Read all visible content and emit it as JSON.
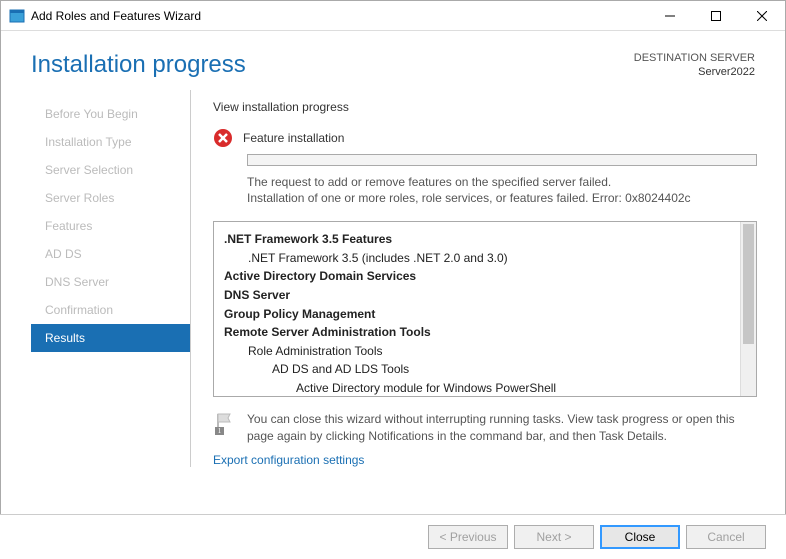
{
  "window": {
    "title": "Add Roles and Features Wizard"
  },
  "header": {
    "title": "Installation progress",
    "dest_label": "DESTINATION SERVER",
    "server_name": "Server2022"
  },
  "sidebar": {
    "steps": [
      {
        "label": "Before You Begin",
        "active": false
      },
      {
        "label": "Installation Type",
        "active": false
      },
      {
        "label": "Server Selection",
        "active": false
      },
      {
        "label": "Server Roles",
        "active": false
      },
      {
        "label": "Features",
        "active": false
      },
      {
        "label": "AD DS",
        "active": false
      },
      {
        "label": "DNS Server",
        "active": false
      },
      {
        "label": "Confirmation",
        "active": false
      },
      {
        "label": "Results",
        "active": true
      }
    ]
  },
  "main": {
    "sub_heading": "View installation progress",
    "status_text": "Feature installation",
    "message_line1": "The request to add or remove features on the specified server failed.",
    "message_line2": "Installation of one or more roles, role services, or features failed. Error: 0x8024402c",
    "features": [
      {
        "label": ".NET Framework 3.5 Features",
        "level": 0,
        "bold": true
      },
      {
        "label": ".NET Framework 3.5 (includes .NET 2.0 and 3.0)",
        "level": 1,
        "bold": false
      },
      {
        "label": "Active Directory Domain Services",
        "level": 0,
        "bold": true
      },
      {
        "label": "DNS Server",
        "level": 0,
        "bold": true
      },
      {
        "label": "Group Policy Management",
        "level": 0,
        "bold": true
      },
      {
        "label": "Remote Server Administration Tools",
        "level": 0,
        "bold": true
      },
      {
        "label": "Role Administration Tools",
        "level": 1,
        "bold": false
      },
      {
        "label": "AD DS and AD LDS Tools",
        "level": 2,
        "bold": false
      },
      {
        "label": "Active Directory module for Windows PowerShell",
        "level": 3,
        "bold": false
      }
    ],
    "info_text": "You can close this wizard without interrupting running tasks. View task progress or open this page again by clicking Notifications in the command bar, and then Task Details.",
    "export_link": "Export configuration settings"
  },
  "footer": {
    "previous": "< Previous",
    "next": "Next >",
    "close": "Close",
    "cancel": "Cancel"
  }
}
